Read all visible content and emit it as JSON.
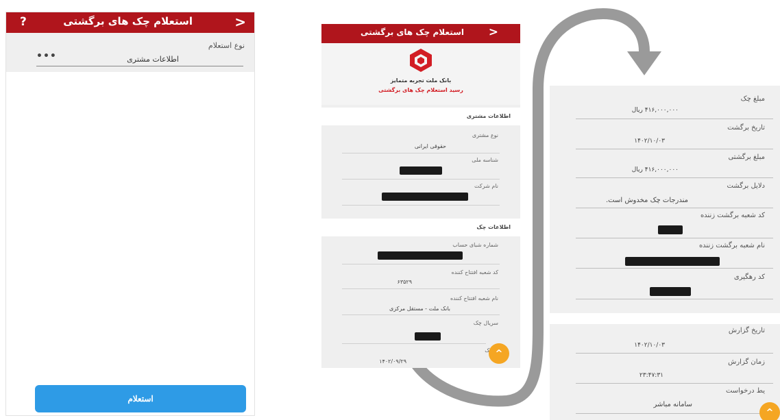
{
  "screen1": {
    "title": "استعلام چک های برگشتی",
    "help_icon": "?",
    "back_icon": ">",
    "inquiry_type_label": "نوع استعلام",
    "inquiry_type_value": "اطلاعات مشتری",
    "more_icon": "•••",
    "submit_label": "استعلام"
  },
  "screen2": {
    "title": "استعلام چک های برگشتی",
    "back_icon": ">",
    "bank_name": "بانک ملت تجربه متمایز",
    "receipt_title": "رسید استعلام چک های برگشتی",
    "customer_section": "اطلاعات مشتری",
    "customer_type_label": "نوع مشتری",
    "customer_type_value": "حقوقی ایرانی",
    "national_id_label": "شناسه ملی",
    "company_name_label": "نام شرکت",
    "check_section": "اطلاعات چک",
    "sheba_label": "شماره شبای حساب",
    "opening_branch_code_label": "کد شعبه افتتاح کننده",
    "opening_branch_code_value": "۶۳۵۲۹",
    "opening_branch_name_label": "نام شعبه افتتاح کننده",
    "opening_branch_name_value": "بانک ملت - مستقل مرکزی",
    "serial_label": "سریال چک",
    "check_date_label_partial": "خ چک",
    "check_date_value": "۱۴۰۲/۰۹/۲۹",
    "fab_icon": "^"
  },
  "screen3": {
    "amount_label": "مبلغ چک",
    "amount_value": "۴۱۶,۰۰۰,۰۰۰ ریال",
    "return_date_label": "تاریخ برگشت",
    "return_date_value": "۱۴۰۲/۱۰/۰۳",
    "return_amount_label": "مبلغ برگشتی",
    "return_amount_value": "۴۱۶,۰۰۰,۰۰۰ ریال",
    "return_reasons_label": "دلایل برگشت",
    "return_reasons_value": "مندرجات چک مخدوش است.",
    "returning_branch_code_label": "کد شعبه برگشت زننده",
    "returning_branch_name_label": "نام شعبه برگشت زننده",
    "tracking_code_label": "کد رهگیری",
    "report_date_label": "تاریخ گزارش",
    "report_date_value": "۱۴۰۲/۱۰/۰۳",
    "report_time_label": "زمان گزارش",
    "report_time_value": "۲۳:۴۷:۳۱",
    "request_channel_label_partial": "یط درخواست",
    "request_channel_value": "سامانه مباشر",
    "fab_icon": "^"
  },
  "colors": {
    "header_red": "#b0151c",
    "button_blue": "#2e9be6",
    "fab_orange": "#f5a623",
    "receipt_red": "#d21d24"
  }
}
